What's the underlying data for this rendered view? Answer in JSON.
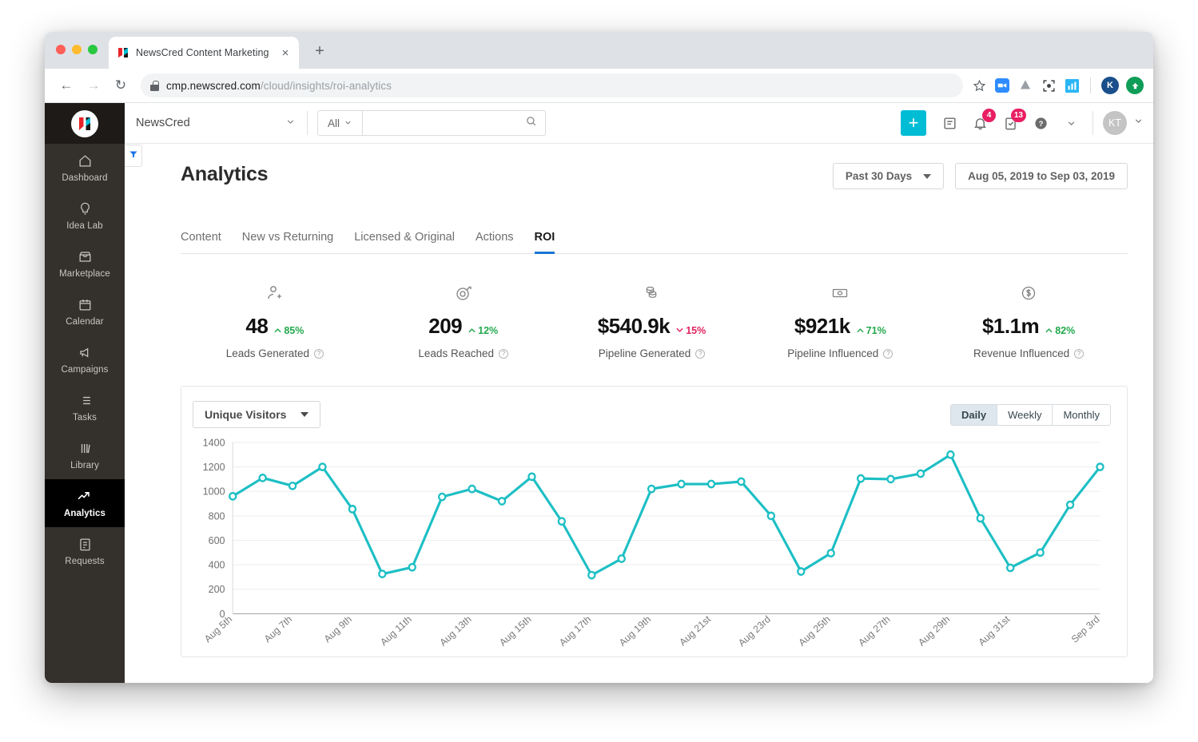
{
  "browser": {
    "tab_title": "NewsCred Content Marketing P",
    "tab_close": "×",
    "new_tab": "+",
    "back": "←",
    "forward": "→",
    "reload": "↻",
    "url_host": "cmp.newscred.com",
    "url_path": "/cloud/insights/roi-analytics",
    "profile_initial": "K"
  },
  "topbar": {
    "org": "NewsCred",
    "scope": "All",
    "search_placeholder": "",
    "search_value": "",
    "add_label": "+",
    "notifications_count": "4",
    "tasks_count": "13",
    "avatar_initials": "KT"
  },
  "sidebar": {
    "items": [
      {
        "label": "Dashboard",
        "icon": "home-icon",
        "active": false
      },
      {
        "label": "Idea Lab",
        "icon": "lightbulb-icon",
        "active": false
      },
      {
        "label": "Marketplace",
        "icon": "storefront-icon",
        "active": false
      },
      {
        "label": "Calendar",
        "icon": "calendar-icon",
        "active": false
      },
      {
        "label": "Campaigns",
        "icon": "megaphone-icon",
        "active": false
      },
      {
        "label": "Tasks",
        "icon": "list-icon",
        "active": false
      },
      {
        "label": "Library",
        "icon": "books-icon",
        "active": false
      },
      {
        "label": "Analytics",
        "icon": "trend-up-icon",
        "active": true
      },
      {
        "label": "Requests",
        "icon": "document-icon",
        "active": false
      }
    ]
  },
  "page": {
    "title": "Analytics",
    "range_preset": "Past 30 Days",
    "range_dates": "Aug 05, 2019 to Sep 03, 2019",
    "tabs": [
      {
        "label": "Content",
        "active": false
      },
      {
        "label": "New vs Returning",
        "active": false
      },
      {
        "label": "Licensed & Original",
        "active": false
      },
      {
        "label": "Actions",
        "active": false
      },
      {
        "label": "ROI",
        "active": true
      }
    ]
  },
  "kpis": [
    {
      "icon": "add-person-icon",
      "value": "48",
      "delta": "85%",
      "direction": "up",
      "label": "Leads Generated"
    },
    {
      "icon": "target-icon",
      "value": "209",
      "delta": "12%",
      "direction": "up",
      "label": "Leads Reached"
    },
    {
      "icon": "coins-icon",
      "value": "$540.9k",
      "delta": "15%",
      "direction": "down",
      "label": "Pipeline Generated"
    },
    {
      "icon": "banknote-icon",
      "value": "$921k",
      "delta": "71%",
      "direction": "up",
      "label": "Pipeline Influenced"
    },
    {
      "icon": "dollar-circle-icon",
      "value": "$1.1m",
      "delta": "82%",
      "direction": "up",
      "label": "Revenue Influenced"
    }
  ],
  "chart_card": {
    "metric_select": "Unique Visitors",
    "granularity": [
      {
        "label": "Daily",
        "active": true
      },
      {
        "label": "Weekly",
        "active": false
      },
      {
        "label": "Monthly",
        "active": false
      }
    ]
  },
  "colors": {
    "accent_teal": "#1dbfc4",
    "brand_cyan": "#00bcd4",
    "positive": "#22a94c",
    "negative": "#e0245e",
    "tab_underline": "#1976d2",
    "sidebar_bg": "#34302c"
  },
  "chart_data": {
    "type": "line",
    "title": "",
    "xlabel": "",
    "ylabel": "",
    "ylim": [
      0,
      1400
    ],
    "yticks": [
      0,
      200,
      400,
      600,
      800,
      1000,
      1200,
      1400
    ],
    "grid": true,
    "legend": "none",
    "series_name": "Unique Visitors",
    "tick_labels": [
      "Aug 5th",
      "Aug 7th",
      "Aug 9th",
      "Aug 11th",
      "Aug 13th",
      "Aug 15th",
      "Aug 17th",
      "Aug 19th",
      "Aug 21st",
      "Aug 23rd",
      "Aug 25th",
      "Aug 27th",
      "Aug 29th",
      "Aug 31st",
      "Sep 3rd"
    ],
    "x": [
      "Aug 5th",
      "Aug 6th",
      "Aug 7th",
      "Aug 8th",
      "Aug 9th",
      "Aug 10th",
      "Aug 11th",
      "Aug 12th",
      "Aug 13th",
      "Aug 14th",
      "Aug 15th",
      "Aug 16th",
      "Aug 17th",
      "Aug 18th",
      "Aug 19th",
      "Aug 20th",
      "Aug 21st",
      "Aug 22nd",
      "Aug 23rd",
      "Aug 24th",
      "Aug 25th",
      "Aug 26th",
      "Aug 27th",
      "Aug 28th",
      "Aug 29th",
      "Aug 30th",
      "Aug 31st",
      "Sep 1st",
      "Sep 2nd",
      "Sep 3rd"
    ],
    "values": [
      960,
      1110,
      1045,
      1200,
      855,
      325,
      380,
      955,
      1020,
      920,
      1120,
      755,
      315,
      450,
      1020,
      1060,
      1060,
      1080,
      800,
      345,
      495,
      1105,
      1100,
      1145,
      1300,
      780,
      375,
      500,
      890,
      1200
    ]
  }
}
